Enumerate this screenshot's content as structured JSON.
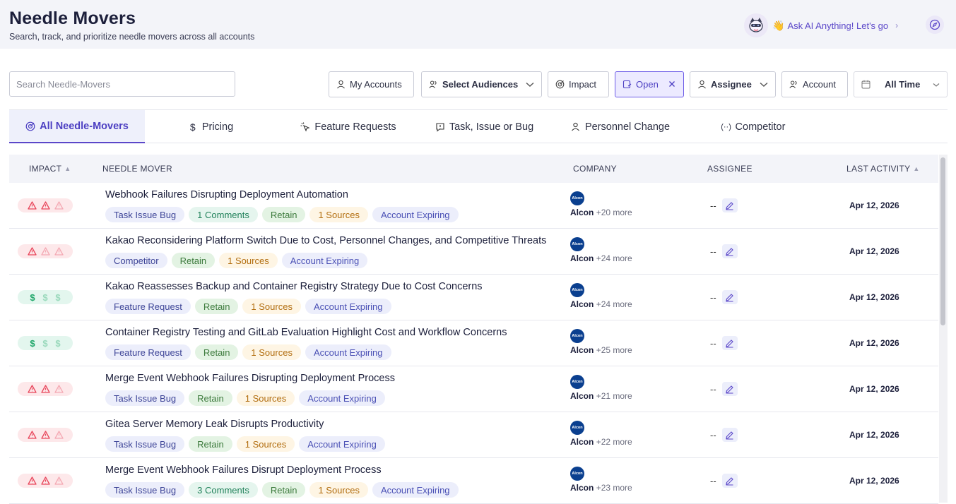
{
  "header": {
    "title": "Needle Movers",
    "subtitle": "Search, track, and prioritize needle movers across all accounts",
    "ai_prompt": "Ask AI Anything! Let's go"
  },
  "search": {
    "placeholder": "Search Needle-Movers",
    "value": ""
  },
  "filters": {
    "my_accounts": "My Accounts",
    "audiences": "Select Audiences",
    "impact": "Impact",
    "status": "Open",
    "assignee": "Assignee",
    "account": "Account",
    "time": "All Time"
  },
  "tabs": [
    {
      "label": "All Needle-Movers",
      "icon": "target-icon"
    },
    {
      "label": "Pricing",
      "icon": "dollar-icon"
    },
    {
      "label": "Feature Requests",
      "icon": "sparkle-pointer-icon"
    },
    {
      "label": "Task, Issue or Bug",
      "icon": "message-alert-icon"
    },
    {
      "label": "Personnel Change",
      "icon": "person-icon"
    },
    {
      "label": "Competitor",
      "icon": "brackets-icon"
    }
  ],
  "table": {
    "columns": {
      "impact": "IMPACT",
      "needle_mover": "NEEDLE MOVER",
      "company": "COMPANY",
      "assignee": "ASSIGNEE",
      "last_activity": "LAST ACTIVITY"
    },
    "rows": [
      {
        "impact_kind": "risk",
        "impact_level": 2,
        "title": "Webhook Failures Disrupting Deployment Automation",
        "tags": {
          "type": "Task Issue Bug",
          "comments": "1 Comments",
          "retain": "Retain",
          "sources": "1 Sources",
          "expiring": "Account Expiring"
        },
        "company": "Alcon",
        "company_more": "+20 more",
        "logo_text": "Alcon",
        "assignee": "--",
        "date": "Apr 12, 2026"
      },
      {
        "impact_kind": "risk",
        "impact_level": 1,
        "title": "Kakao Reconsidering Platform Switch Due to Cost, Personnel Changes, and Competitive Threats",
        "tags": {
          "type": "Competitor",
          "retain": "Retain",
          "sources": "1 Sources",
          "expiring": "Account Expiring"
        },
        "company": "Alcon",
        "company_more": "+24 more",
        "logo_text": "Alcon",
        "assignee": "--",
        "date": "Apr 12, 2026"
      },
      {
        "impact_kind": "money",
        "impact_level": 1,
        "title": "Kakao Reassesses Backup and Container Registry Strategy Due to Cost Concerns",
        "tags": {
          "type": "Feature Request",
          "retain": "Retain",
          "sources": "1 Sources",
          "expiring": "Account Expiring"
        },
        "company": "Alcon",
        "company_more": "+24 more",
        "logo_text": "Alcon",
        "assignee": "--",
        "date": "Apr 12, 2026"
      },
      {
        "impact_kind": "money",
        "impact_level": 1,
        "title": "Container Registry Testing and GitLab Evaluation Highlight Cost and Workflow Concerns",
        "tags": {
          "type": "Feature Request",
          "retain": "Retain",
          "sources": "1 Sources",
          "expiring": "Account Expiring"
        },
        "company": "Alcon",
        "company_more": "+25 more",
        "logo_text": "Alcon",
        "assignee": "--",
        "date": "Apr 12, 2026"
      },
      {
        "impact_kind": "risk",
        "impact_level": 2,
        "title": "Merge Event Webhook Failures Disrupting Deployment Process",
        "tags": {
          "type": "Task Issue Bug",
          "retain": "Retain",
          "sources": "1 Sources",
          "expiring": "Account Expiring"
        },
        "company": "Alcon",
        "company_more": "+21 more",
        "logo_text": "Alcon",
        "assignee": "--",
        "date": "Apr 12, 2026"
      },
      {
        "impact_kind": "risk",
        "impact_level": 2,
        "title": "Gitea Server Memory Leak Disrupts Productivity",
        "tags": {
          "type": "Task Issue Bug",
          "retain": "Retain",
          "sources": "1 Sources",
          "expiring": "Account Expiring"
        },
        "company": "Alcon",
        "company_more": "+22 more",
        "logo_text": "Alcon",
        "assignee": "--",
        "date": "Apr 12, 2026"
      },
      {
        "impact_kind": "risk",
        "impact_level": 2,
        "title": "Merge Event Webhook Failures Disrupt Deployment Process",
        "tags": {
          "type": "Task Issue Bug",
          "comments": "3 Comments",
          "retain": "Retain",
          "sources": "1 Sources",
          "expiring": "Account Expiring"
        },
        "company": "Alcon",
        "company_more": "+23 more",
        "logo_text": "Alcon",
        "assignee": "--",
        "date": "Apr 12, 2026"
      }
    ]
  },
  "colors": {
    "accent": "#5b47c9",
    "risk": "#e8455a",
    "risk_dim": "#f4a9b3",
    "money": "#1fa76a",
    "money_dim": "#9ad9bc"
  }
}
